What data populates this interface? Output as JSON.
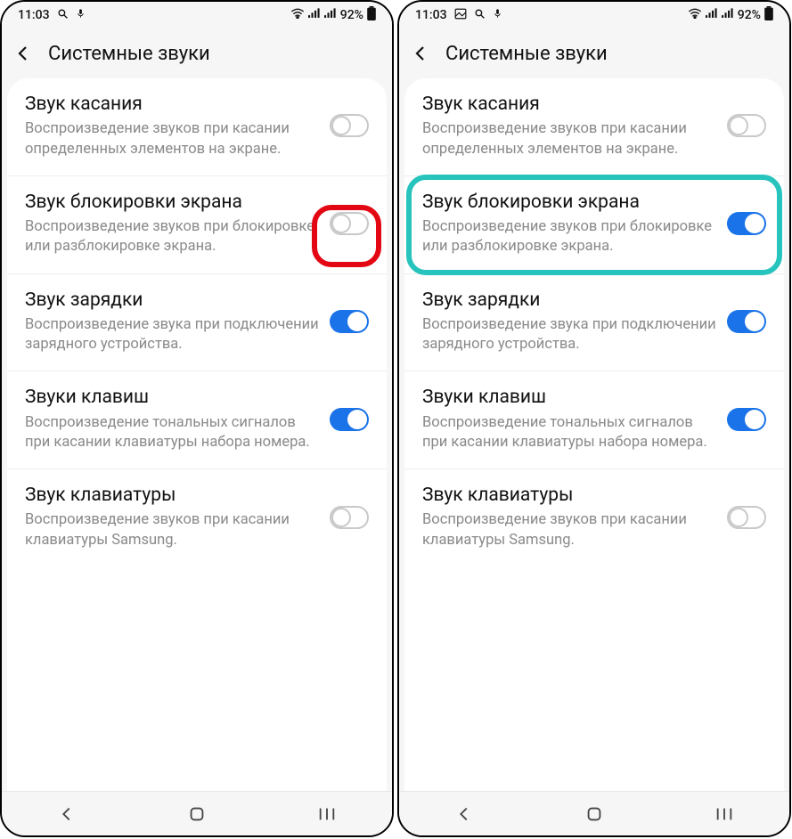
{
  "status": {
    "time": "11:03",
    "battery_text": "92%"
  },
  "header": {
    "title": "Системные звуки"
  },
  "settings": [
    {
      "title": "Звук касания",
      "desc": "Воспроизведение звуков при касании определенных элементов на экране.",
      "on_left": false,
      "on_right": false
    },
    {
      "title": "Звук блокировки экрана",
      "desc": "Воспроизведение звуков при блокировке или разблокировке экрана.",
      "on_left": false,
      "on_right": true
    },
    {
      "title": "Звук зарядки",
      "desc": "Воспроизведение звука при подключении зарядного устройства.",
      "on_left": true,
      "on_right": true
    },
    {
      "title": "Звуки клавиш",
      "desc": "Воспроизведение тональных сигналов при касании клавиатуры набора номера.",
      "on_left": true,
      "on_right": true
    },
    {
      "title": "Звук клавиатуры",
      "desc": "Воспроизведение звуков при касании клавиатуры Samsung.",
      "on_left": false,
      "on_right": false
    }
  ],
  "highlights": {
    "left": {
      "type": "red-circle",
      "target_index": 1,
      "target": "toggle"
    },
    "right": {
      "type": "teal-box",
      "target_index": 1,
      "target": "row"
    }
  }
}
